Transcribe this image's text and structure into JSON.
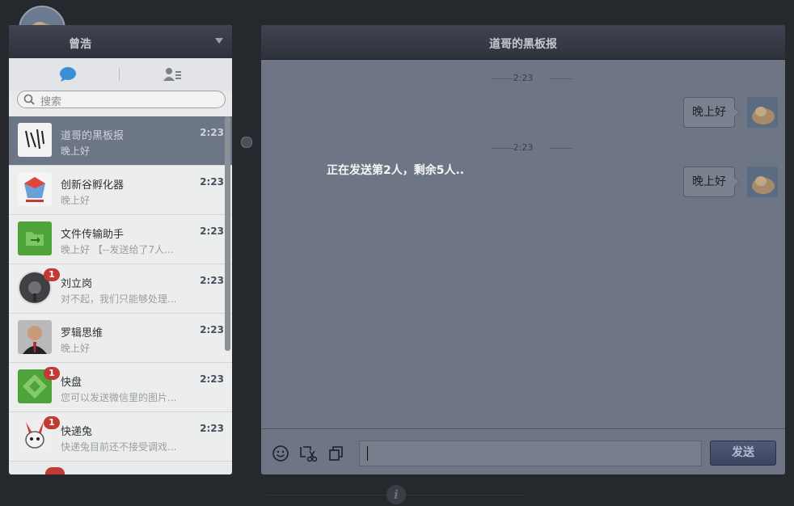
{
  "user": {
    "name": "曾浩"
  },
  "search": {
    "placeholder": "搜索"
  },
  "sessions": [
    {
      "name": "道哥的黑板报",
      "preview": "晚上好",
      "time": "2:23",
      "active": true
    },
    {
      "name": "创新谷孵化器",
      "preview": "晚上好",
      "time": "2:23"
    },
    {
      "name": "文件传输助手",
      "preview": "晚上好 【--发送给了7人...",
      "time": "2:23"
    },
    {
      "name": "刘立岗",
      "preview": "对不起，我们只能够处理...",
      "time": "2:23",
      "badge": "1"
    },
    {
      "name": "罗辑思维",
      "preview": "晚上好",
      "time": "2:23"
    },
    {
      "name": "快盘",
      "preview": "您可以发送微信里的图片...",
      "time": "2:23",
      "badge": "1"
    },
    {
      "name": "快递兔",
      "preview": "快递兔目前还不接受调戏...",
      "time": "2:23",
      "badge": "1"
    }
  ],
  "chat": {
    "title": "道哥的黑板报",
    "messages": [
      {
        "time": "2:23",
        "text": "晚上好"
      },
      {
        "time": "2:23",
        "text": "晚上好"
      }
    ],
    "status": "正在发送第2人，剩余5人..",
    "send_label": "发送"
  },
  "info_icon": "i",
  "colors": {
    "background": "#25282d",
    "header": "#2e323b",
    "active_row": "#6d7686",
    "badge": "#c23a34"
  }
}
